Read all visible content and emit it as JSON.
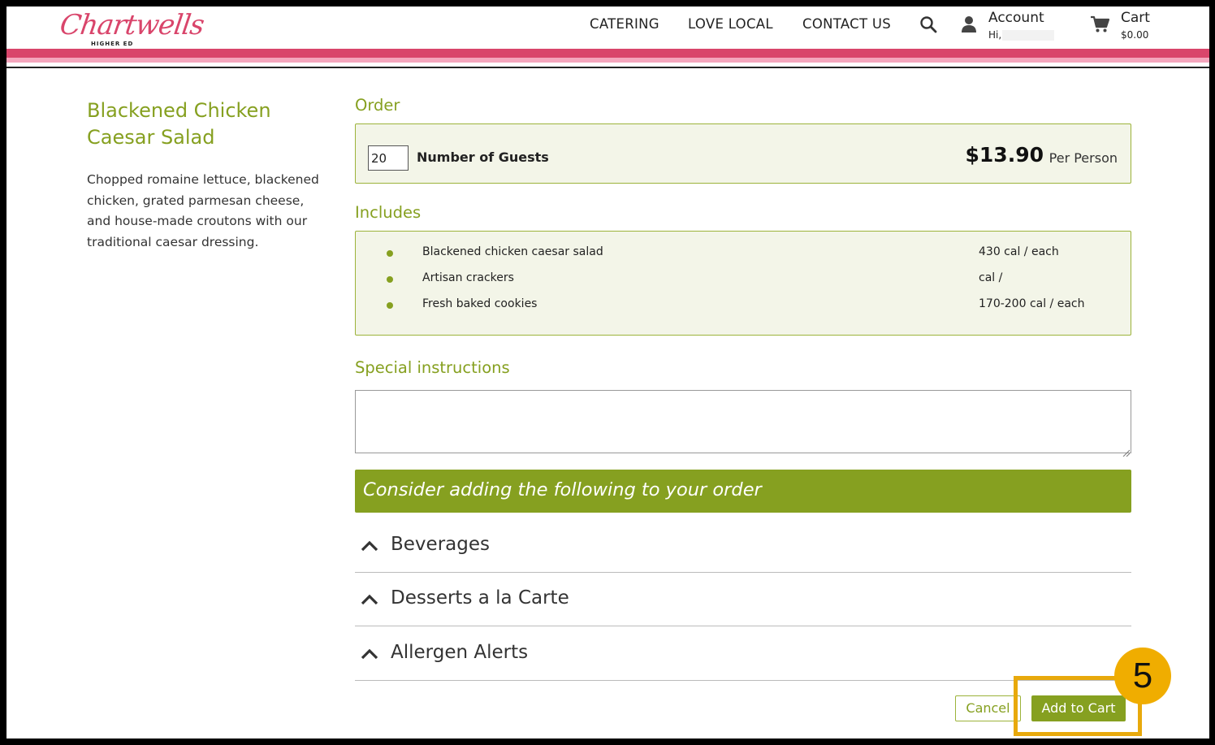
{
  "header": {
    "logo_text": "Chartwells",
    "logo_subtext": "HIGHER ED",
    "nav": [
      "CATERING",
      "LOVE LOCAL",
      "CONTACT US"
    ],
    "account_label": "Account",
    "account_greeting": "Hi,",
    "cart_label": "Cart",
    "cart_total": "$0.00"
  },
  "item": {
    "title": "Blackened Chicken Caesar Salad",
    "description": "Chopped romaine lettuce, blackened chicken, grated parmesan cheese, and house-made croutons with our traditional caesar dressing."
  },
  "order": {
    "heading": "Order",
    "guests_value": "20",
    "guests_label": "Number of Guests",
    "price": "$13.90",
    "price_unit": "Per Person"
  },
  "includes": {
    "heading": "Includes",
    "items": [
      {
        "name": "Blackened chicken caesar salad",
        "calories": "430 cal / each"
      },
      {
        "name": "Artisan crackers",
        "calories": "cal /"
      },
      {
        "name": "Fresh baked cookies",
        "calories": "170-200 cal / each"
      }
    ]
  },
  "special": {
    "heading": "Special instructions",
    "value": ""
  },
  "suggest": {
    "banner": "Consider adding the following to your order",
    "sections": [
      "Beverages",
      "Desserts a la Carte",
      "Allergen Alerts"
    ]
  },
  "actions": {
    "cancel_label": "Cancel",
    "add_label": "Add to Cart"
  },
  "annotation": {
    "step_number": "5"
  },
  "colors": {
    "brand_pink": "#d9456b",
    "accent_green": "#86a020",
    "highlight_gold": "#e8a90c"
  }
}
